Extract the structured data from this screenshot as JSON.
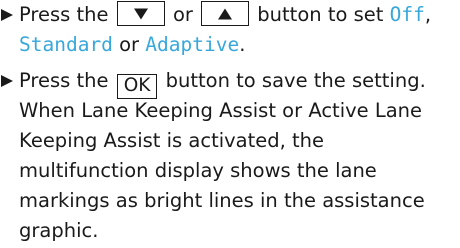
{
  "step1": {
    "line1_pre": "Press the",
    "key_down_label": "down-arrow-key",
    "between_keys": "or",
    "key_up_label": "up-arrow-key",
    "line1_post": "button to set",
    "option_off": "Off",
    "option_standard": "Standard",
    "line2_between": "or",
    "option_adaptive": "Adaptive",
    "line2_end": "."
  },
  "step2": {
    "line1_pre": "Press the",
    "key_ok": "OK",
    "line1_post": "button to save the setting.",
    "line2": "When Lane Keeping Assist or Active Lane",
    "line3": "Keeping Assist is activated, the",
    "line4": "multifunction display shows the lane",
    "line5": "markings as bright lines in the assistance",
    "line6": "graphic."
  },
  "colors": {
    "highlight": "#38a8dc",
    "text": "#1a1a1a"
  }
}
